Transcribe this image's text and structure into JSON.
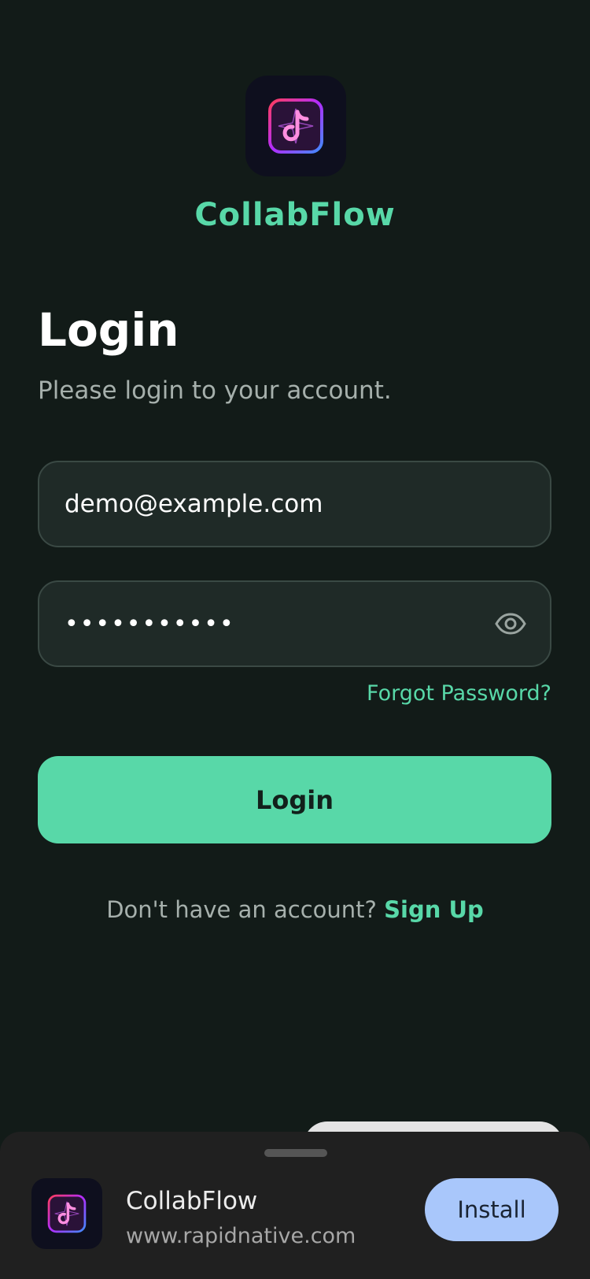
{
  "app": {
    "name": "CollabFlow",
    "logo_icon": "music-note-app-icon"
  },
  "form": {
    "title": "Login",
    "subtitle": "Please login to your account.",
    "email": {
      "value": "demo@example.com"
    },
    "password": {
      "value": "•••••••••••",
      "toggle_icon": "eye-icon"
    },
    "forgot_label": "Forgot Password?",
    "login_button_label": "Login",
    "signup_prompt": "Don't have an account?",
    "signup_label": "Sign Up"
  },
  "install_banner": {
    "title": "CollabFlow",
    "url": "www.rapidnative.com",
    "button_label": "Install"
  },
  "colors": {
    "background": "#121b18",
    "accent": "#58d8a8",
    "field": "#1f2a27",
    "install_button": "#a9c7fb"
  }
}
